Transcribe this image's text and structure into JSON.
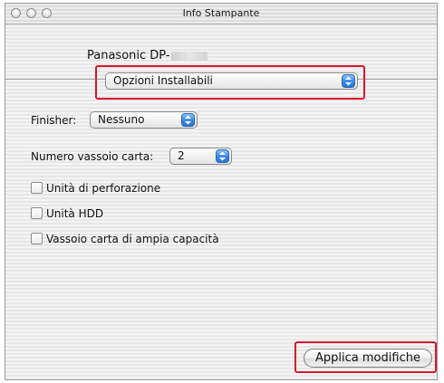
{
  "window": {
    "title": "Info Stampante"
  },
  "printer": {
    "name": "Panasonic DP-"
  },
  "category_popup": {
    "value": "Opzioni Installabili"
  },
  "finisher": {
    "label": "Finisher:",
    "value": "Nessuno"
  },
  "tray_count": {
    "label": "Numero vassoio carta:",
    "value": "2"
  },
  "options": [
    {
      "label": "Unità di perforazione",
      "checked": false
    },
    {
      "label": "Unità HDD",
      "checked": false
    },
    {
      "label": "Vassoio carta di ampia capacità",
      "checked": false
    }
  ],
  "apply_button": {
    "label": "Applica modifiche"
  },
  "colors": {
    "highlight": "#d8182c",
    "popup_arrow": "#3c8de8"
  }
}
